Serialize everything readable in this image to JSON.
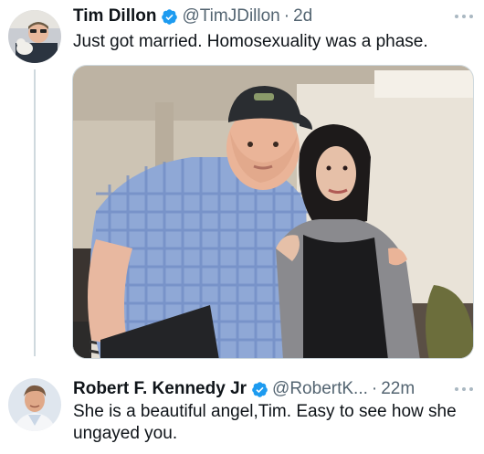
{
  "tweets": [
    {
      "author_name": "Tim Dillon",
      "handle": "@TimJDillon",
      "separator": "·",
      "time": "2d",
      "text": "Just got married. Homosexuality was a phase.",
      "avatar_icon": "profile-photo",
      "has_media": true
    },
    {
      "author_name": "Robert F. Kennedy Jr",
      "handle": "@RobertK...",
      "separator": "·",
      "time": "22m",
      "text": "She is a beautiful angel,Tim. Easy to see how she ungayed you.",
      "avatar_icon": "profile-photo",
      "has_media": false
    }
  ],
  "colors": {
    "text": "#0f1419",
    "secondary": "#536471",
    "verified": "#1d9bf0",
    "thread_line": "#cfd9de"
  }
}
